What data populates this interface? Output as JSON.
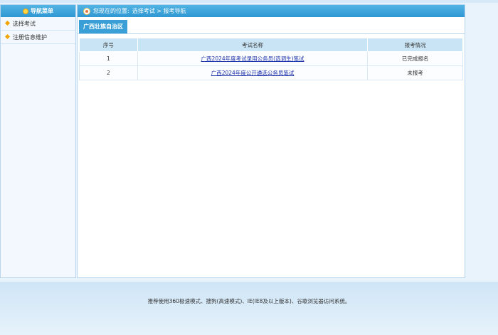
{
  "sidebar": {
    "title": "导航菜单",
    "items": [
      {
        "label": "选择考试"
      },
      {
        "label": "注册信息维护"
      }
    ]
  },
  "breadcrumb": {
    "prefix": "您现在的位置:",
    "path": "选择考试 > 报考导航"
  },
  "tab": {
    "label": "广西壮族自治区"
  },
  "table": {
    "columns": [
      "序号",
      "考试名称",
      "报考情况"
    ],
    "rows": [
      {
        "index": "1",
        "name": "广西2024年度考试录用公务员(选调生)笔试",
        "status": "已完成报名"
      },
      {
        "index": "2",
        "name": "广西2024年度公开遴选公务员笔试",
        "status": "未报考"
      }
    ]
  },
  "footer": {
    "text": "推荐使用360极速模式、搜狗(高速模式)、IE(IE8及以上版本)、谷歌浏览器访问系统。"
  }
}
